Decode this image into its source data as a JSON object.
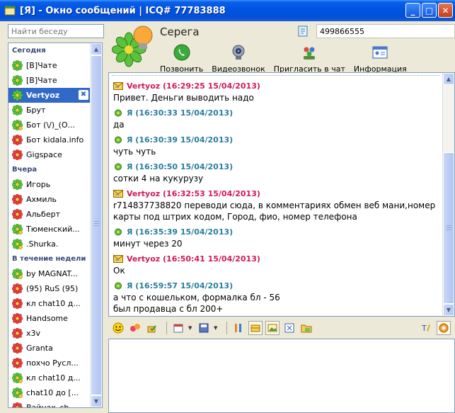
{
  "window": {
    "title": "[Я] - Окно сообщений | ICQ# 77783888",
    "minimize": "_",
    "maximize": "□",
    "close": "✕"
  },
  "sidebar": {
    "search_placeholder": "Найти беседу",
    "groups": [
      {
        "label": "Сегодня",
        "items": [
          {
            "name": "[В]Чате",
            "status": "online",
            "selected": false
          },
          {
            "name": "[В]Чате",
            "status": "online",
            "selected": false
          },
          {
            "name": "Vertyoz",
            "status": "online",
            "selected": true
          },
          {
            "name": "Брут",
            "status": "online",
            "selected": false
          },
          {
            "name": "Бот (\\/)_(О...",
            "status": "online-away",
            "selected": false
          },
          {
            "name": "Бот kidala.info",
            "status": "offline",
            "selected": false
          },
          {
            "name": "Gigspace",
            "status": "offline",
            "selected": false
          }
        ]
      },
      {
        "label": "Вчера",
        "items": [
          {
            "name": "Игорь",
            "status": "online",
            "selected": false
          },
          {
            "name": "Ахмиль",
            "status": "offline",
            "selected": false
          },
          {
            "name": "Альберт",
            "status": "offline",
            "selected": false
          },
          {
            "name": "Тюменский...",
            "status": "online-away",
            "selected": false
          },
          {
            "name": ".Shurka.",
            "status": "online-away",
            "selected": false
          }
        ]
      },
      {
        "label": "В течение недели",
        "items": [
          {
            "name": "by MAGNAT...",
            "status": "online-away",
            "selected": false
          },
          {
            "name": "(95) RuS (95)",
            "status": "offline",
            "selected": false
          },
          {
            "name": "кл chat10 д...",
            "status": "offline",
            "selected": false
          },
          {
            "name": "Handsome",
            "status": "offline",
            "selected": false
          },
          {
            "name": "x3v",
            "status": "offline",
            "selected": false
          },
          {
            "name": "Granta",
            "status": "offline",
            "selected": false
          },
          {
            "name": "похчо Русл...",
            "status": "offline",
            "selected": false
          },
          {
            "name": "кл chat10 д...",
            "status": "online-away",
            "selected": false
          },
          {
            "name": "chat10 до [...",
            "status": "online-away",
            "selected": false
          },
          {
            "name": "Вайнах_сh...",
            "status": "offline",
            "selected": false
          }
        ]
      }
    ]
  },
  "contact": {
    "name": "Серега",
    "uin": "499866555"
  },
  "actions": [
    {
      "label": "Позвонить",
      "icon": "phone-icon"
    },
    {
      "label": "Видеозвонок",
      "icon": "webcam-icon"
    },
    {
      "label": "Пригласить в чат",
      "icon": "users-icon"
    },
    {
      "label": "Информация",
      "icon": "info-card-icon"
    }
  ],
  "messages": [
    {
      "sender": "them",
      "header": "Vertyoz (16:29:25 15/04/2013)",
      "text": "Привет. Деньги выводить надо"
    },
    {
      "sender": "me",
      "header": "Я (16:30:33 15/04/2013)",
      "text": "да"
    },
    {
      "sender": "me",
      "header": "Я (16:30:39 15/04/2013)",
      "text": "чуть чуть"
    },
    {
      "sender": "me",
      "header": "Я (16:30:50 15/04/2013)",
      "text": "сотки 4 на кукурузу"
    },
    {
      "sender": "them",
      "header": "Vertyoz (16:32:53 15/04/2013)",
      "text": "r714837738820 переводи сюда, в комментариях обмен веб мани,номер карты под штрих кодом, Город, фио, номер телефона"
    },
    {
      "sender": "me",
      "header": "Я (16:35:39 15/04/2013)",
      "text": "минут через 20"
    },
    {
      "sender": "them",
      "header": "Vertyoz (16:50:41 15/04/2013)",
      "text": "Ок"
    },
    {
      "sender": "me",
      "header": "Я (16:59:57 15/04/2013)",
      "text": "а что с кошельком, формалка бл - 56\nбыл продавца с бл 200+"
    }
  ],
  "colors": {
    "them": "#D0195A",
    "me": "#2A7D9C",
    "selection": "#3169C6"
  }
}
